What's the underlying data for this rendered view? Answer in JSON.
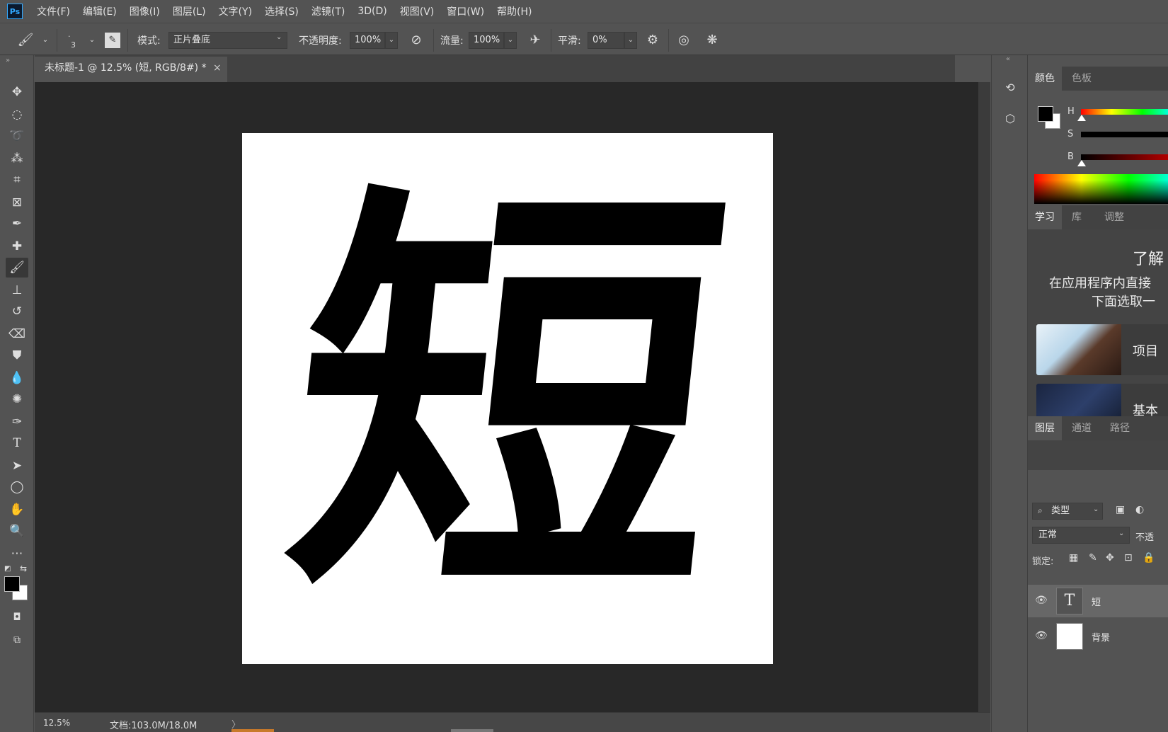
{
  "app": {
    "logo": "Ps",
    "menu": [
      "文件(F)",
      "编辑(E)",
      "图像(I)",
      "图层(L)",
      "文字(Y)",
      "选择(S)",
      "滤镜(T)",
      "3D(D)",
      "视图(V)",
      "窗口(W)",
      "帮助(H)"
    ]
  },
  "options": {
    "brush_size": "3",
    "mode_label": "模式:",
    "mode_value": "正片叠底",
    "opacity_label": "不透明度:",
    "opacity_value": "100%",
    "flow_label": "流量:",
    "flow_value": "100%",
    "smooth_label": "平滑:",
    "smooth_value": "0%"
  },
  "document": {
    "tab_title": "未标题-1 @ 12.5% (短, RGB/8#) *",
    "glyph": "短"
  },
  "status": {
    "zoom": "12.5%",
    "doc_info": "文档:103.0M/18.0M"
  },
  "panels": {
    "color_tabs": [
      "颜色",
      "色板"
    ],
    "sliders": [
      "H",
      "S",
      "B"
    ],
    "learn_tabs": [
      "学习",
      "库",
      "调整"
    ],
    "learn_title": "了解",
    "learn_desc1": "在应用程序内直接",
    "learn_desc2": "下面选取一",
    "cards": [
      "项目",
      "基本"
    ],
    "layer_tabs": [
      "图层",
      "通道",
      "路径"
    ],
    "filter_type": "类型",
    "blend_mode": "正常",
    "opacity_short": "不透",
    "lock_label": "锁定:",
    "layers": [
      {
        "name": "短",
        "type": "text"
      },
      {
        "name": "背景",
        "type": "background"
      }
    ]
  },
  "colors": {
    "foreground": "#000000",
    "background": "#ffffff",
    "accent": "#31a8ff"
  }
}
